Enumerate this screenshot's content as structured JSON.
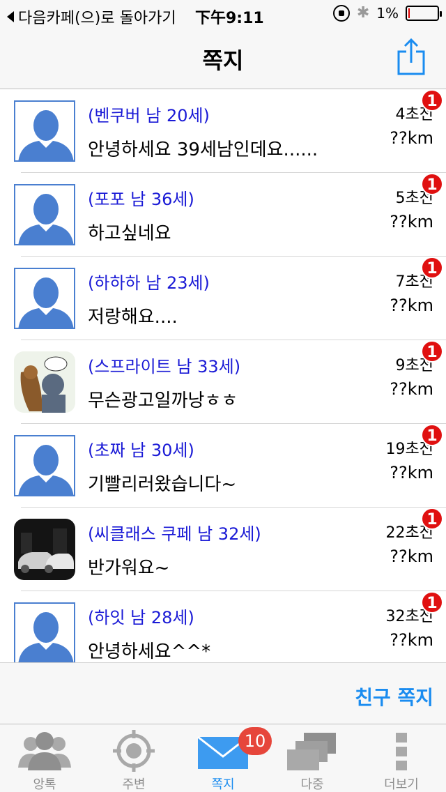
{
  "status_bar": {
    "back_label": "다음카페(으)로 돌아가기",
    "time": "下午9:11",
    "battery": "1%"
  },
  "nav": {
    "title": "쪽지"
  },
  "messages": [
    {
      "name": "(벤쿠버 남 20세)",
      "text": "안녕하세요 39세남인데요......",
      "time": "4초전",
      "distance": "??km",
      "badge": "1",
      "avatar": "default"
    },
    {
      "name": "(포포 남 36세)",
      "text": "하고싶네요",
      "time": "5초전",
      "distance": "??km",
      "badge": "1",
      "avatar": "default"
    },
    {
      "name": "(하하하 남 23세)",
      "text": "저랑해요....",
      "time": "7초전",
      "distance": "??km",
      "badge": "1",
      "avatar": "default"
    },
    {
      "name": "(스프라이트 남 33세)",
      "text": "무슨광고일까낭ㅎㅎ",
      "time": "9초전",
      "distance": "??km",
      "badge": "1",
      "avatar": "cartoon"
    },
    {
      "name": "(초짜 남 30세)",
      "text": "기빨리러왔습니다~",
      "time": "19초전",
      "distance": "??km",
      "badge": "1",
      "avatar": "default"
    },
    {
      "name": "(씨클래스 쿠페 남 32세)",
      "text": "반가워요~",
      "time": "22초전",
      "distance": "??km",
      "badge": "1",
      "avatar": "car"
    },
    {
      "name": "(하잇 남 28세)",
      "text": "안녕하세요^^*",
      "time": "32초전",
      "distance": "??km",
      "badge": "1",
      "avatar": "default"
    }
  ],
  "friend_note_button": "친구 쪽지",
  "tabs": [
    {
      "label": "앙톡",
      "icon": "people-icon"
    },
    {
      "label": "주변",
      "icon": "target-icon"
    },
    {
      "label": "쪽지",
      "icon": "mail-icon",
      "badge": "10",
      "active": true
    },
    {
      "label": "다중",
      "icon": "multi-mail-icon"
    },
    {
      "label": "더보기",
      "icon": "more-icon"
    }
  ],
  "colors": {
    "accent": "#1a8cf0",
    "name_blue": "#1a1ad6",
    "badge_red": "#e01010",
    "avatar_blue": "#4a7fd0"
  }
}
